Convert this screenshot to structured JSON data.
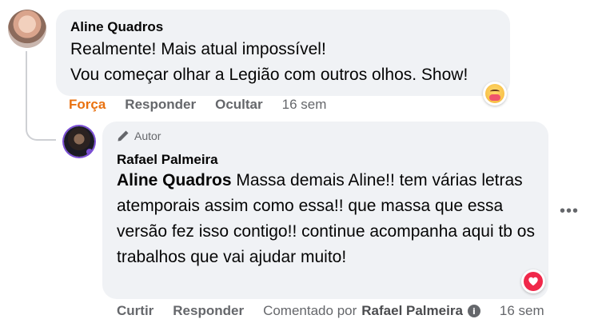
{
  "comments": [
    {
      "author": "Aline Quadros",
      "text_lines": [
        "Realmente! Mais atual impossível!",
        "Vou começar olhar a Legião com outros olhos. Show!"
      ],
      "reaction_icon": "care-reaction-icon",
      "actions": {
        "reaction_label": "Força",
        "reply_label": "Responder",
        "hide_label": "Ocultar",
        "timestamp": "16 sem"
      }
    },
    {
      "badge_label": "Autor",
      "author": "Rafael Palmeira",
      "mention": "Aline Quadros",
      "text": " Massa demais Aline!! tem várias letras atemporais assim como essa!! que massa que essa versão fez isso contigo!! continue acompanha aqui tb os trabalhos que vai ajudar muito!",
      "reaction_icon": "love-reaction-icon",
      "actions": {
        "like_label": "Curtir",
        "reply_label": "Responder",
        "commented_by_prefix": "Comentado por",
        "commented_by_name": "Rafael Palmeira",
        "timestamp": "16 sem"
      }
    }
  ],
  "more_button": "•••",
  "colors": {
    "bubble": "#f0f2f5",
    "secondary_text": "#65676b",
    "care_reaction_active": "#e9710f",
    "love": "#f0284a"
  }
}
